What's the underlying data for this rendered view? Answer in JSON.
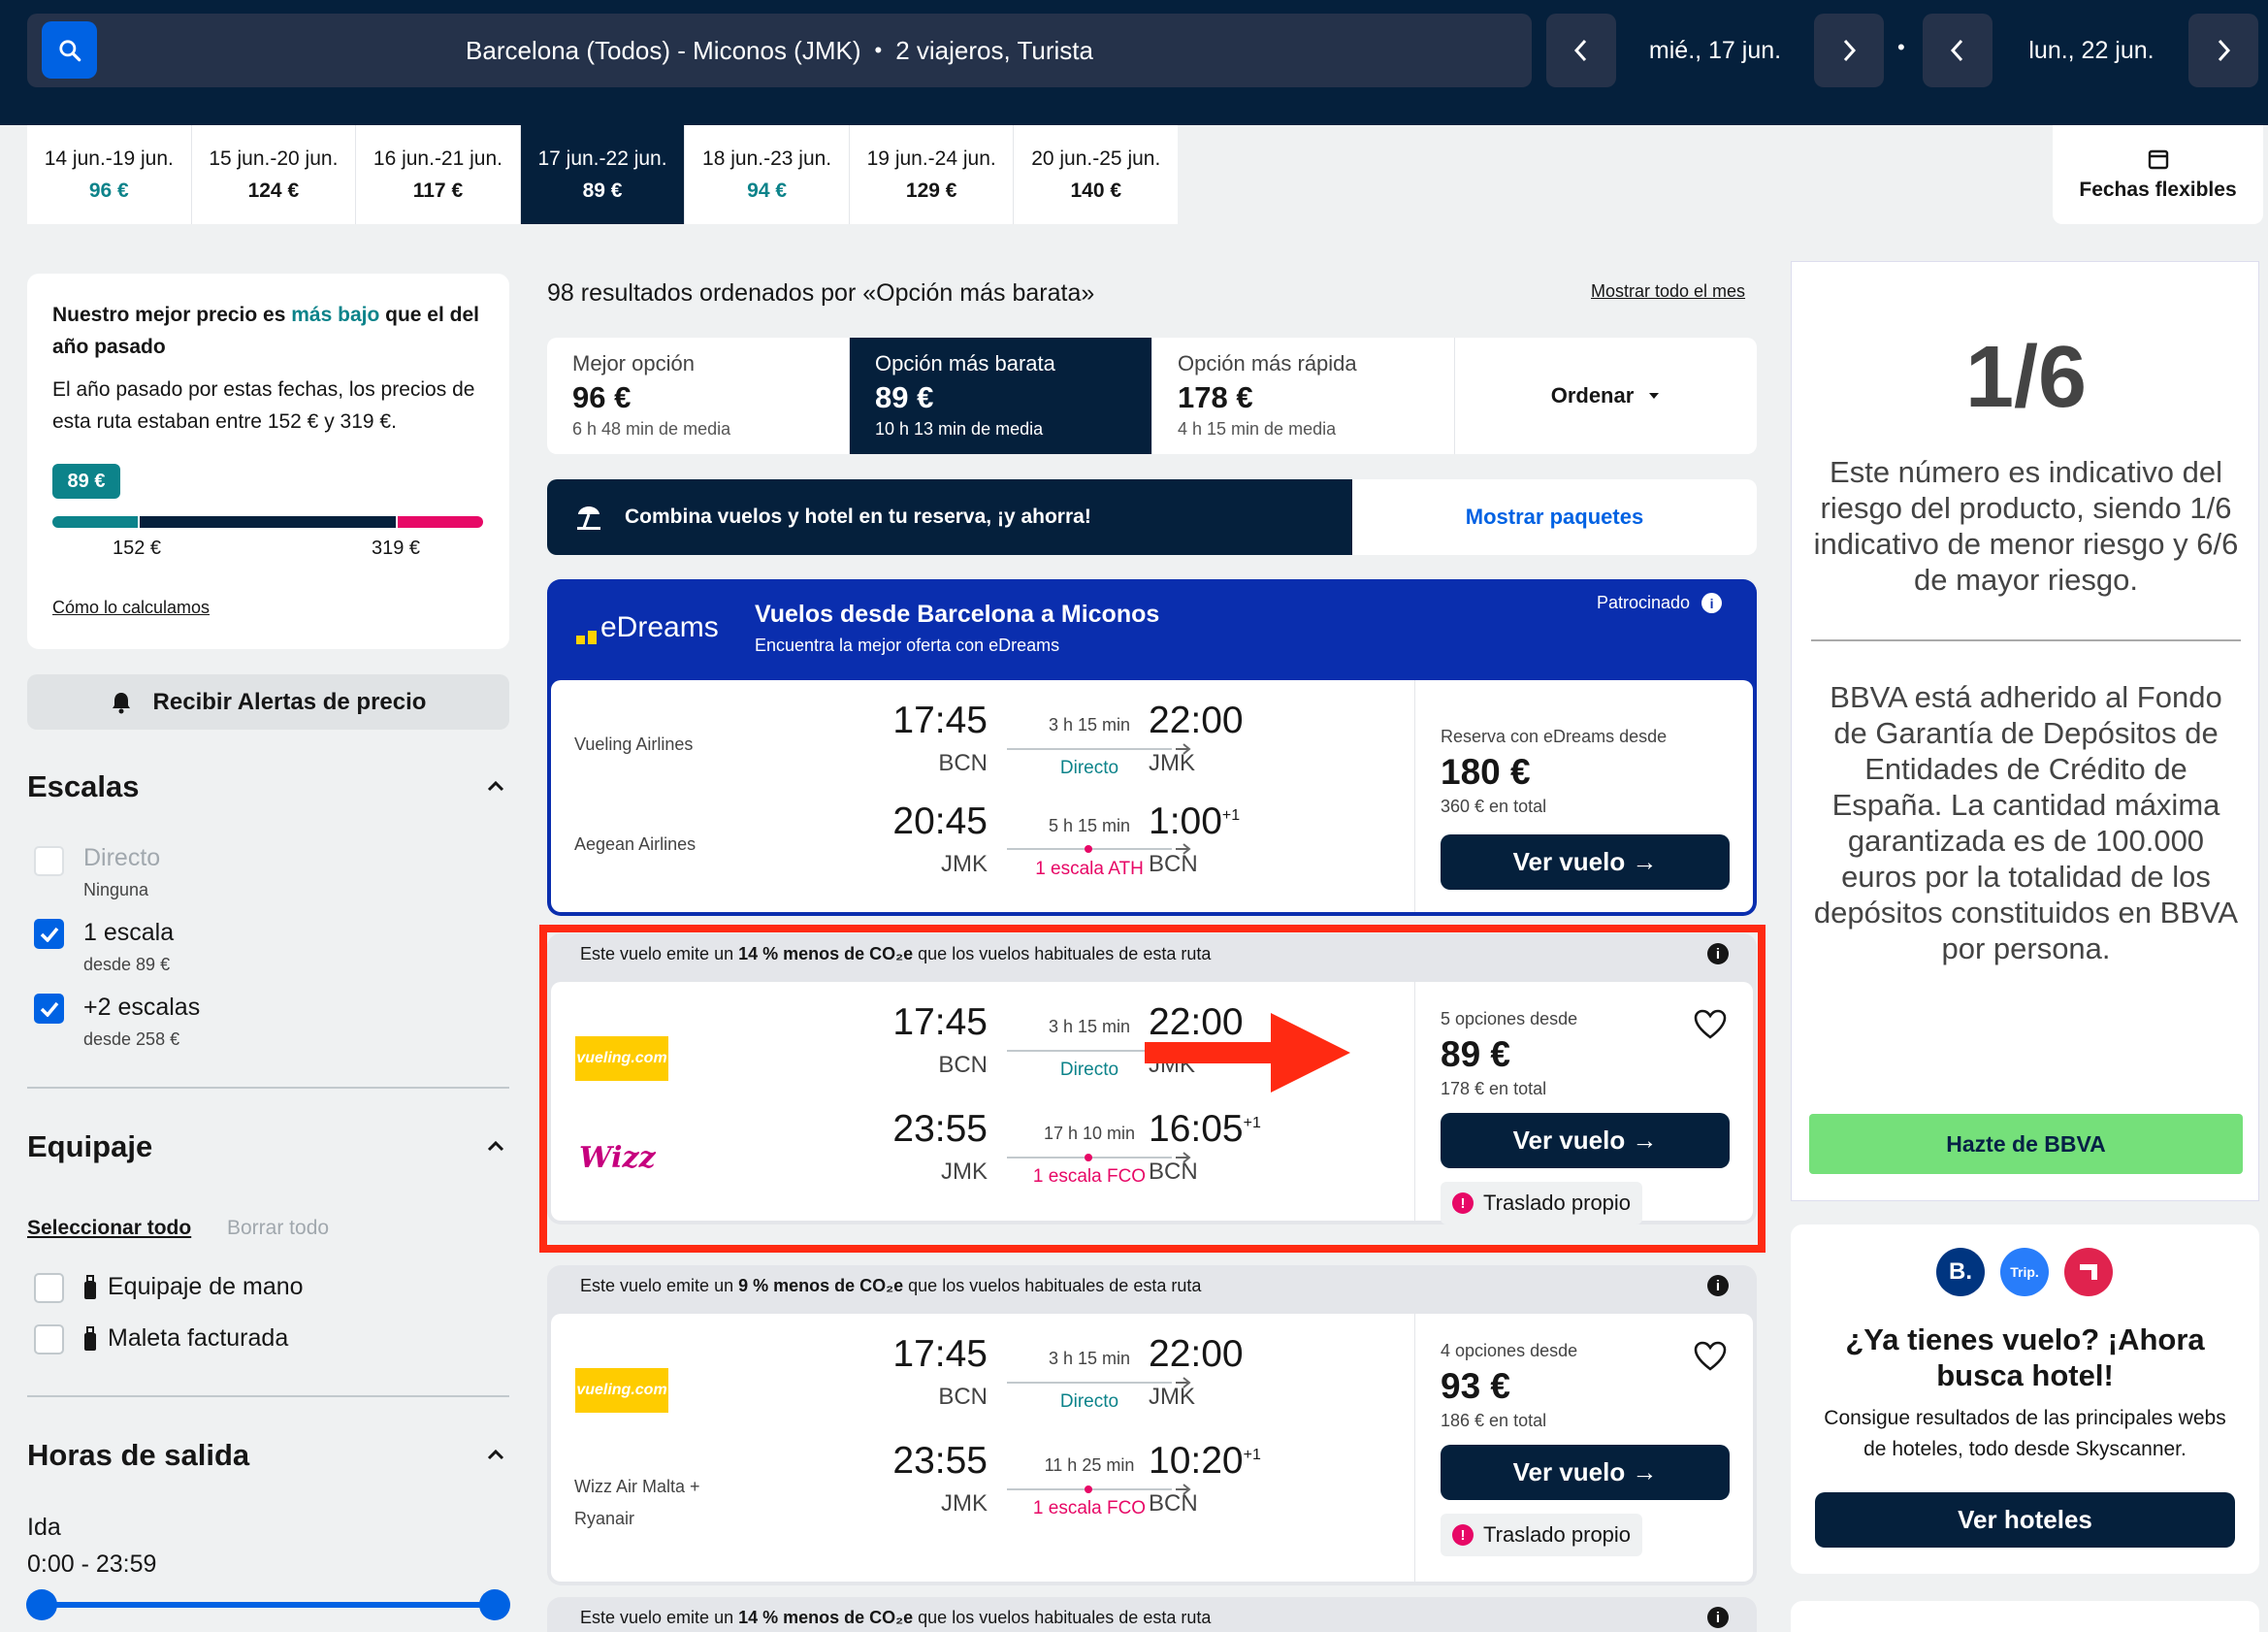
{
  "header": {
    "search_text": "Barcelona (Todos) - Miconos (JMK)",
    "travellers": "2 viajeros, Turista",
    "date_out": "mié., 17 jun.",
    "date_back": "lun., 22 jun."
  },
  "date_strip": [
    {
      "range": "14 jun.-19 jun.",
      "price": "96 €",
      "cheap": true
    },
    {
      "range": "15 jun.-20 jun.",
      "price": "124 €",
      "cheap": false
    },
    {
      "range": "16 jun.-21 jun.",
      "price": "117 €",
      "cheap": false
    },
    {
      "range": "17 jun.-22 jun.",
      "price": "89 €",
      "cheap": false
    },
    {
      "range": "18 jun.-23 jun.",
      "price": "94 €",
      "cheap": true
    },
    {
      "range": "19 jun.-24 jun.",
      "price": "129 €",
      "cheap": false
    },
    {
      "range": "20 jun.-25 jun.",
      "price": "140 €",
      "cheap": false
    }
  ],
  "flexible_dates": "Fechas flexibles",
  "price_insight": {
    "title_pre": "Nuestro mejor precio es ",
    "title_hl": "más bajo",
    "title_post": " que el del año pasado",
    "body": "El año pasado por estas fechas, los precios de esta ruta estaban entre 152 € y 319 €.",
    "badge": "89 €",
    "low": "152 €",
    "high": "319 €",
    "link": "Cómo lo calculamos"
  },
  "alerts_button": "Recibir Alertas de precio",
  "filters": {
    "stops_title": "Escalas",
    "stops": [
      {
        "label": "Directo",
        "sub": "Ninguna",
        "checked": false,
        "disabled": true
      },
      {
        "label": "1 escala",
        "sub": "desde 89 €",
        "checked": true,
        "disabled": false
      },
      {
        "label": "+2 escalas",
        "sub": "desde 258 €",
        "checked": true,
        "disabled": false
      }
    ],
    "baggage_title": "Equipaje",
    "select_all": "Seleccionar todo",
    "clear_all": "Borrar todo",
    "baggage": [
      "Equipaje de mano",
      "Maleta facturada"
    ],
    "times_title": "Horas de salida",
    "outbound": "Ida",
    "outbound_range": "0:00 - 23:59"
  },
  "results": {
    "summary": "98 resultados ordenados por «Opción más barata»",
    "month_link": "Mostrar todo el mes",
    "sort": [
      {
        "title": "Mejor opción",
        "price": "96 €",
        "sub": "6 h 48 min de media"
      },
      {
        "title": "Opción más barata",
        "price": "89 €",
        "sub": "10 h 13 min de media"
      },
      {
        "title": "Opción más rápida",
        "price": "178 €",
        "sub": "4 h 15 min de media"
      }
    ],
    "order_label": "Ordenar",
    "combo_text": "Combina vuelos y hotel en tu reserva, ¡y ahorra!",
    "combo_link": "Mostrar paquetes"
  },
  "sponsored": {
    "brand": "eDreams",
    "title": "Vuelos desde Barcelona a Miconos",
    "subtitle": "Encuentra la mejor oferta con eDreams",
    "tag": "Patrocinado",
    "legs": [
      {
        "airline": "Vueling Airlines",
        "dep": "17:45",
        "dep_code": "BCN",
        "dur": "3 h 15 min",
        "stops": "Directo",
        "arr": "22:00",
        "arr_code": "JMK",
        "plus": ""
      },
      {
        "airline": "Aegean Airlines",
        "dep": "20:45",
        "dep_code": "JMK",
        "dur": "5 h 15 min",
        "stops": "1 escala ATH",
        "arr": "1:00",
        "arr_code": "BCN",
        "plus": "+1"
      }
    ],
    "price_label": "Reserva con eDreams desde",
    "price": "180 €",
    "total": "360 € en total",
    "button": "Ver vuelo →"
  },
  "cards": [
    {
      "eco_pre": "Este vuelo emite un ",
      "eco_bold": "14 % menos de CO₂e",
      "eco_post": " que los vuelos habituales de esta ruta",
      "legs": [
        {
          "airline": "vueling.com",
          "dep": "17:45",
          "dep_code": "BCN",
          "dur": "3 h 15 min",
          "stops": "Directo",
          "arr": "22:00",
          "arr_code": "JMK",
          "plus": ""
        },
        {
          "airline": "Wizz",
          "dep": "23:55",
          "dep_code": "JMK",
          "dur": "17 h 10 min",
          "stops": "1 escala FCO",
          "arr": "16:05",
          "arr_code": "BCN",
          "plus": "+1"
        }
      ],
      "options": "5 opciones desde",
      "price": "89 €",
      "total": "178 € en total",
      "button": "Ver vuelo →",
      "self_transfer": "Traslado propio"
    },
    {
      "eco_pre": "Este vuelo emite un ",
      "eco_bold": "9 % menos de CO₂e",
      "eco_post": " que los vuelos habituales de esta ruta",
      "legs": [
        {
          "airline": "vueling.com",
          "dep": "17:45",
          "dep_code": "BCN",
          "dur": "3 h 15 min",
          "stops": "Directo",
          "arr": "22:00",
          "arr_code": "JMK",
          "plus": ""
        },
        {
          "airline": "Wizz Air Malta + Ryanair",
          "dep": "23:55",
          "dep_code": "JMK",
          "dur": "11 h 25 min",
          "stops": "1 escala FCO",
          "arr": "10:20",
          "arr_code": "BCN",
          "plus": "+1"
        }
      ],
      "options": "4 opciones desde",
      "price": "93 €",
      "total": "186 € en total",
      "button": "Ver vuelo →",
      "self_transfer": "Traslado propio"
    }
  ],
  "third_eco": {
    "pre": "Este vuelo emite un ",
    "bold": "14 % menos de CO₂e",
    "post": " que los vuelos habituales de esta ruta"
  },
  "ad": {
    "risk": "1/6",
    "risk_text": "Este número es indicativo del riesgo del producto, siendo 1/6 indicativo de menor riesgo y 6/6 de mayor riesgo.",
    "fund_text": "BBVA está adherido al Fondo de Garantía de Depósitos de Entidades de Crédito de España. La cantidad máxima garantizada es de 100.000 euros por la totalidad de los depósitos constituidos en BBVA por persona.",
    "button": "Hazte de BBVA"
  },
  "hotel_promo": {
    "logos": [
      "B.",
      "Trip."
    ],
    "title": "¿Ya tienes vuelo? ¡Ahora busca hotel!",
    "body": "Consigue resultados de las principales webs de hoteles, todo desde Skyscanner.",
    "button": "Ver hoteles"
  },
  "colors": {
    "navy": "#05203c",
    "blue": "#0062e3",
    "teal": "#0c838a",
    "pink": "#e70866",
    "highlight": "#ff2a12",
    "bbva_green": "#75e07a"
  }
}
